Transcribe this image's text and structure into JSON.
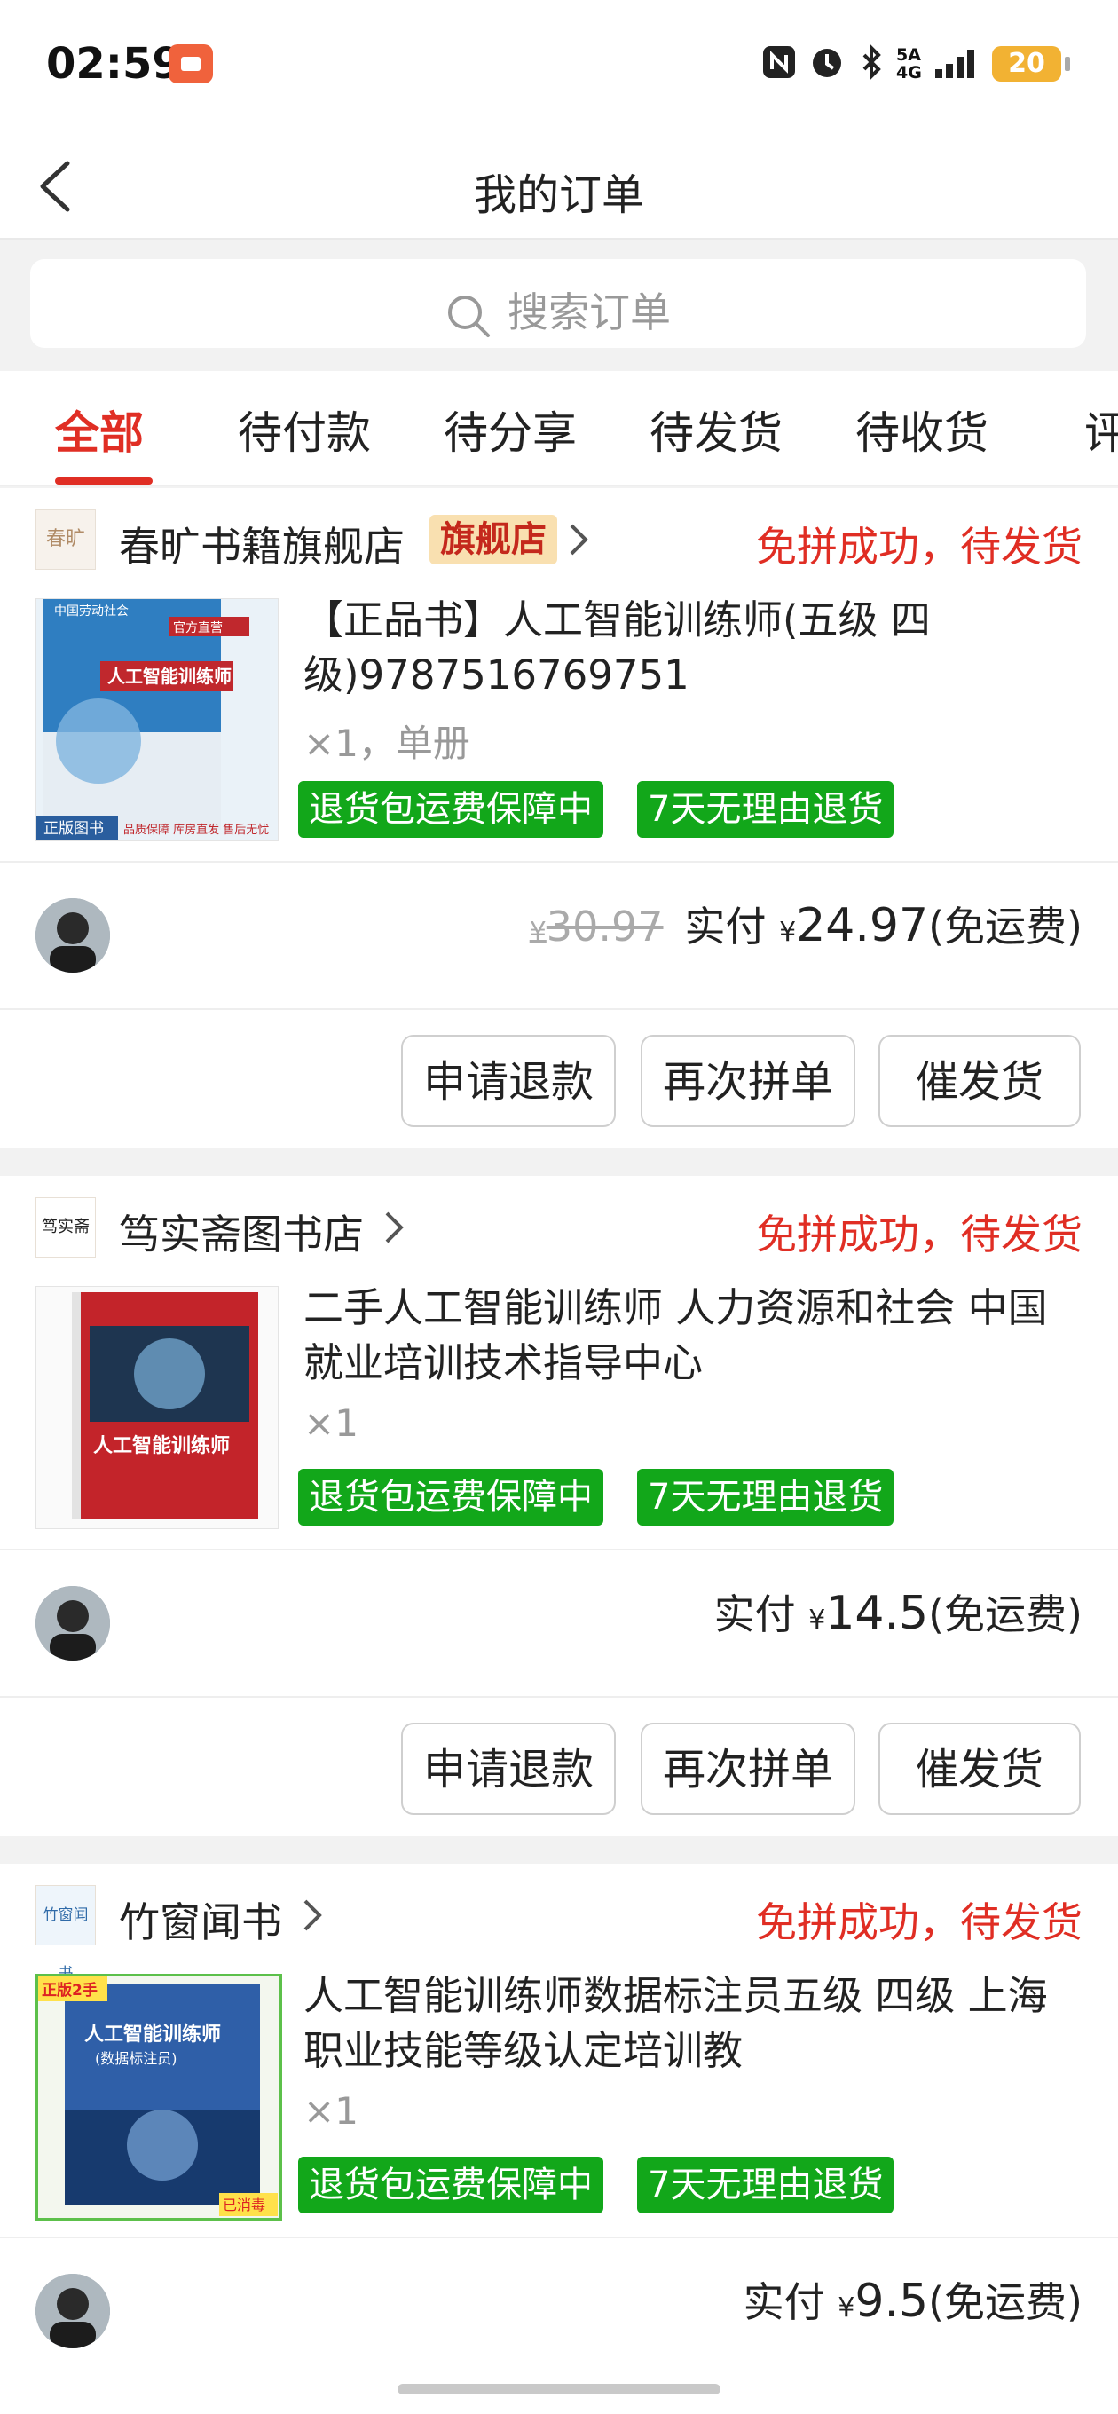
{
  "status_bar": {
    "time": "02:59",
    "network": "5A\n4G",
    "battery": "20"
  },
  "header": {
    "title": "我的订单"
  },
  "search": {
    "placeholder": "搜索订单"
  },
  "tabs": [
    "全部",
    "待付款",
    "待分享",
    "待发货",
    "待收货",
    "评"
  ],
  "active_tab": 0,
  "orders": [
    {
      "shop_logo_text": "春旷",
      "shop_name": "春旷书籍旗舰店",
      "flag": "旗舰店",
      "status": "免拼成功，待发货",
      "title": "【正品书】人工智能训练师(五级 四级)9787516769751",
      "qty": "×1，单册",
      "badges": [
        "退货包运费保障中",
        "7天无理由退货"
      ],
      "original_price": "30.97",
      "paid_label": "实付",
      "currency": "¥",
      "paid": "24.97",
      "shipping": "(免运费)",
      "buttons": [
        "申请退款",
        "再次拼单",
        "催发货"
      ]
    },
    {
      "shop_logo_text": "笃实斋",
      "shop_name": "笃实斋图书店",
      "flag": "",
      "status": "免拼成功，待发货",
      "title": "二手人工智能训练师 人力资源和社会 中国就业培训技术指导中心",
      "qty": "×1",
      "badges": [
        "退货包运费保障中",
        "7天无理由退货"
      ],
      "original_price": "",
      "paid_label": "实付",
      "currency": "¥",
      "paid": "14.5",
      "shipping": "(免运费)",
      "buttons": [
        "申请退款",
        "再次拼单",
        "催发货"
      ]
    },
    {
      "shop_logo_text": "竹窗闻书",
      "shop_name": "竹窗闻书",
      "flag": "",
      "status": "免拼成功，待发货",
      "title": "人工智能训练师数据标注员五级 四级 上海职业技能等级认定培训教",
      "qty": "×1",
      "badges": [
        "退货包运费保障中",
        "7天无理由退货"
      ],
      "original_price": "",
      "paid_label": "实付",
      "currency": "¥",
      "paid": "9.5",
      "shipping": "(免运费)",
      "buttons": []
    }
  ],
  "cover_texts": {
    "book1_series": "中国劳动社会",
    "book1_tag": "官方直营",
    "book1_title": "人工智能训练师",
    "book1_banner": "正版图书",
    "book1_footer": "品质保障 库房直发 售后无忧",
    "book2_title": "人工智能训练师",
    "book3_corner": "正版2手",
    "book3_title": "人工智能训练师",
    "book3_sub": "(数据标注员)",
    "book3_stamp": "已消毒"
  },
  "colors": {
    "accent": "#e02e24",
    "badge_green": "#12a71a",
    "flag_bg": "#f9e0b0"
  }
}
